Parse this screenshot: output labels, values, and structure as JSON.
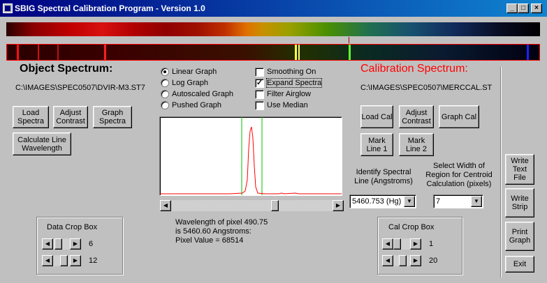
{
  "window": {
    "title": "SBIG Spectral Calibration Program - Version 1.0",
    "controls": [
      "minimize",
      "maximize",
      "close"
    ]
  },
  "object": {
    "heading": "Object Spectrum:",
    "path": "C:\\IMAGES\\SPEC0507\\DVIR-M3.ST7",
    "buttons": {
      "load": "Load Spectra",
      "adjust": "Adjust Contrast",
      "graph": "Graph Spectra",
      "calc": "Calculate Line Wavelength"
    },
    "crop": {
      "title": "Data Crop Box",
      "value1": "6",
      "value2": "12"
    }
  },
  "options": {
    "radios": [
      {
        "label": "Linear Graph",
        "checked": true
      },
      {
        "label": "Log Graph",
        "checked": false
      },
      {
        "label": "Autoscaled Graph",
        "checked": false
      },
      {
        "label": "Pushed Graph",
        "checked": false
      }
    ],
    "checks": [
      {
        "label": "Smoothing On",
        "checked": false
      },
      {
        "label": "Expand Spectra",
        "checked": true
      },
      {
        "label": "Filter Airglow",
        "checked": false
      },
      {
        "label": "Use Median",
        "checked": false
      }
    ]
  },
  "graph": {
    "scroll_fraction": 0.65,
    "readout_line1": "Wavelength of pixel 490.75",
    "readout_line2": "is 5460.60 Angstroms:",
    "readout_line3": "Pixel Value = 68514"
  },
  "calibration": {
    "heading": "Calibration Spectrum:",
    "heading_color": "#ff0000",
    "path": "C:\\IMAGES\\SPEC0507\\MERCCAL.ST",
    "buttons": {
      "load": "Load Cal",
      "adjust": "Adjust Contrast",
      "graph": "Graph Cal",
      "mark1": "Mark Line 1",
      "mark2": "Mark Line 2"
    },
    "identify_label": "Identify Spectral Line (Angstroms)",
    "identify_value": "5460.753 (Hg)",
    "width_label": "Select Width of Region for Centroid Calculation (pixels)",
    "width_value": "7",
    "crop": {
      "title": "Cal Crop Box",
      "value1": "1",
      "value2": "20"
    }
  },
  "side_buttons": {
    "write_text": "Write Text File",
    "write_strip": "Write Strip",
    "print_graph": "Print Graph",
    "exit": "Exit"
  }
}
